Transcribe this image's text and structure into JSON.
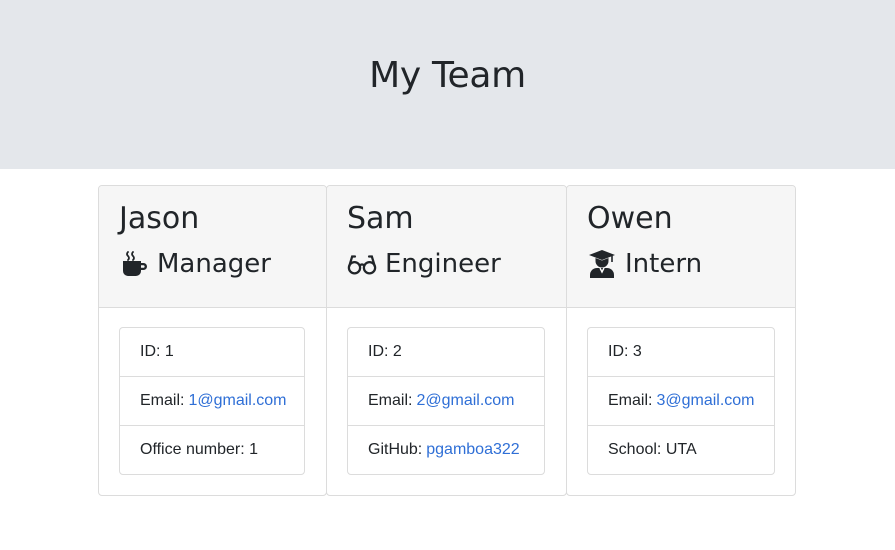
{
  "header": {
    "title": "My Team"
  },
  "team": [
    {
      "name": "Jason",
      "role": "Manager",
      "role_icon": "coffee-icon",
      "id_label": "ID:",
      "id": "1",
      "email_label": "Email:",
      "email": "1@gmail.com",
      "extra_label": "Office number:",
      "extra_value": "1"
    },
    {
      "name": "Sam",
      "role": "Engineer",
      "role_icon": "glasses-icon",
      "id_label": "ID:",
      "id": "2",
      "email_label": "Email:",
      "email": "2@gmail.com",
      "extra_label": "GitHub:",
      "extra_value": "pgamboa322"
    },
    {
      "name": "Owen",
      "role": "Intern",
      "role_icon": "user-graduate-icon",
      "id_label": "ID:",
      "id": "3",
      "email_label": "Email:",
      "email": "3@gmail.com",
      "extra_label": "School:",
      "extra_value": "UTA"
    }
  ],
  "colors": {
    "header_bg": "#e4e7eb",
    "card_header_bg": "#f6f6f6",
    "link": "#2f6fd6",
    "border": "#dcdcdc"
  }
}
